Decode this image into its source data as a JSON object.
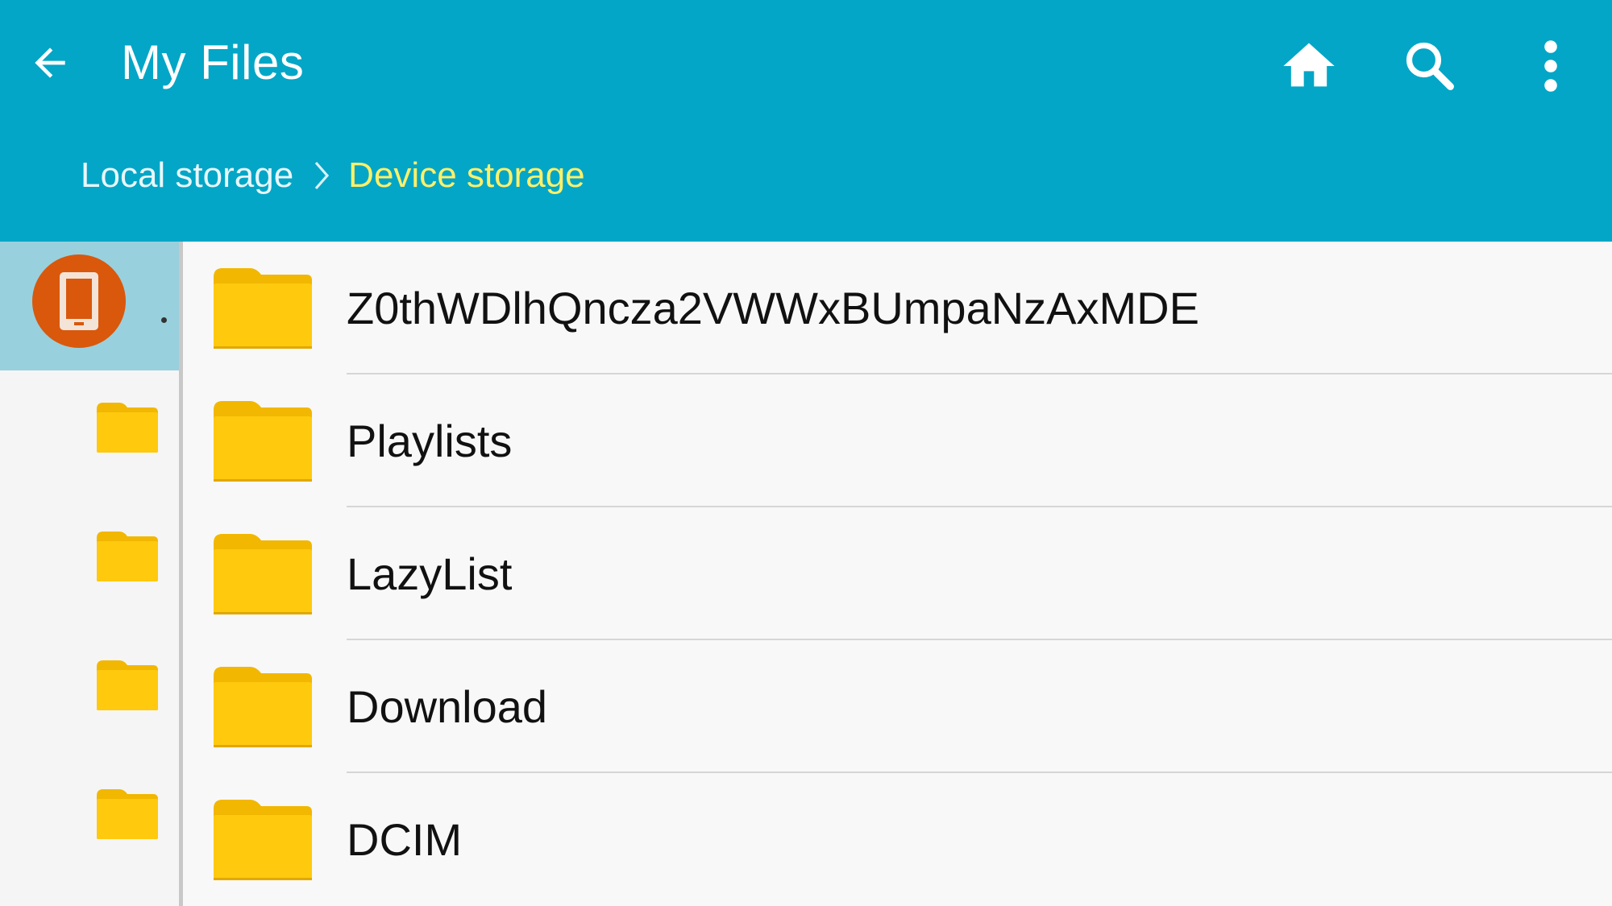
{
  "header": {
    "title": "My Files",
    "back_icon": "arrow-back-icon",
    "actions": [
      {
        "name": "home",
        "icon": "home-icon"
      },
      {
        "name": "search",
        "icon": "search-icon"
      },
      {
        "name": "more",
        "icon": "more-vert-icon"
      }
    ],
    "background": "#03a6c6"
  },
  "breadcrumb": {
    "items": [
      "Local storage",
      "Device storage"
    ],
    "separator_icon": "chevron-right-icon",
    "active_color": "#fff06a"
  },
  "sidebar": {
    "selected_storage_icon": "phone-icon",
    "avatar_color": "#d9580c",
    "folder_count": 4
  },
  "files": [
    {
      "name": "Z0thWDlhQncza2VWWxBUmpaNzAxMDE",
      "icon": "folder-icon"
    },
    {
      "name": "Playlists",
      "icon": "folder-icon"
    },
    {
      "name": "LazyList",
      "icon": "folder-icon"
    },
    {
      "name": "Download",
      "icon": "folder-icon"
    },
    {
      "name": "DCIM",
      "icon": "folder-icon"
    }
  ],
  "folder_color": "#ffc90e"
}
